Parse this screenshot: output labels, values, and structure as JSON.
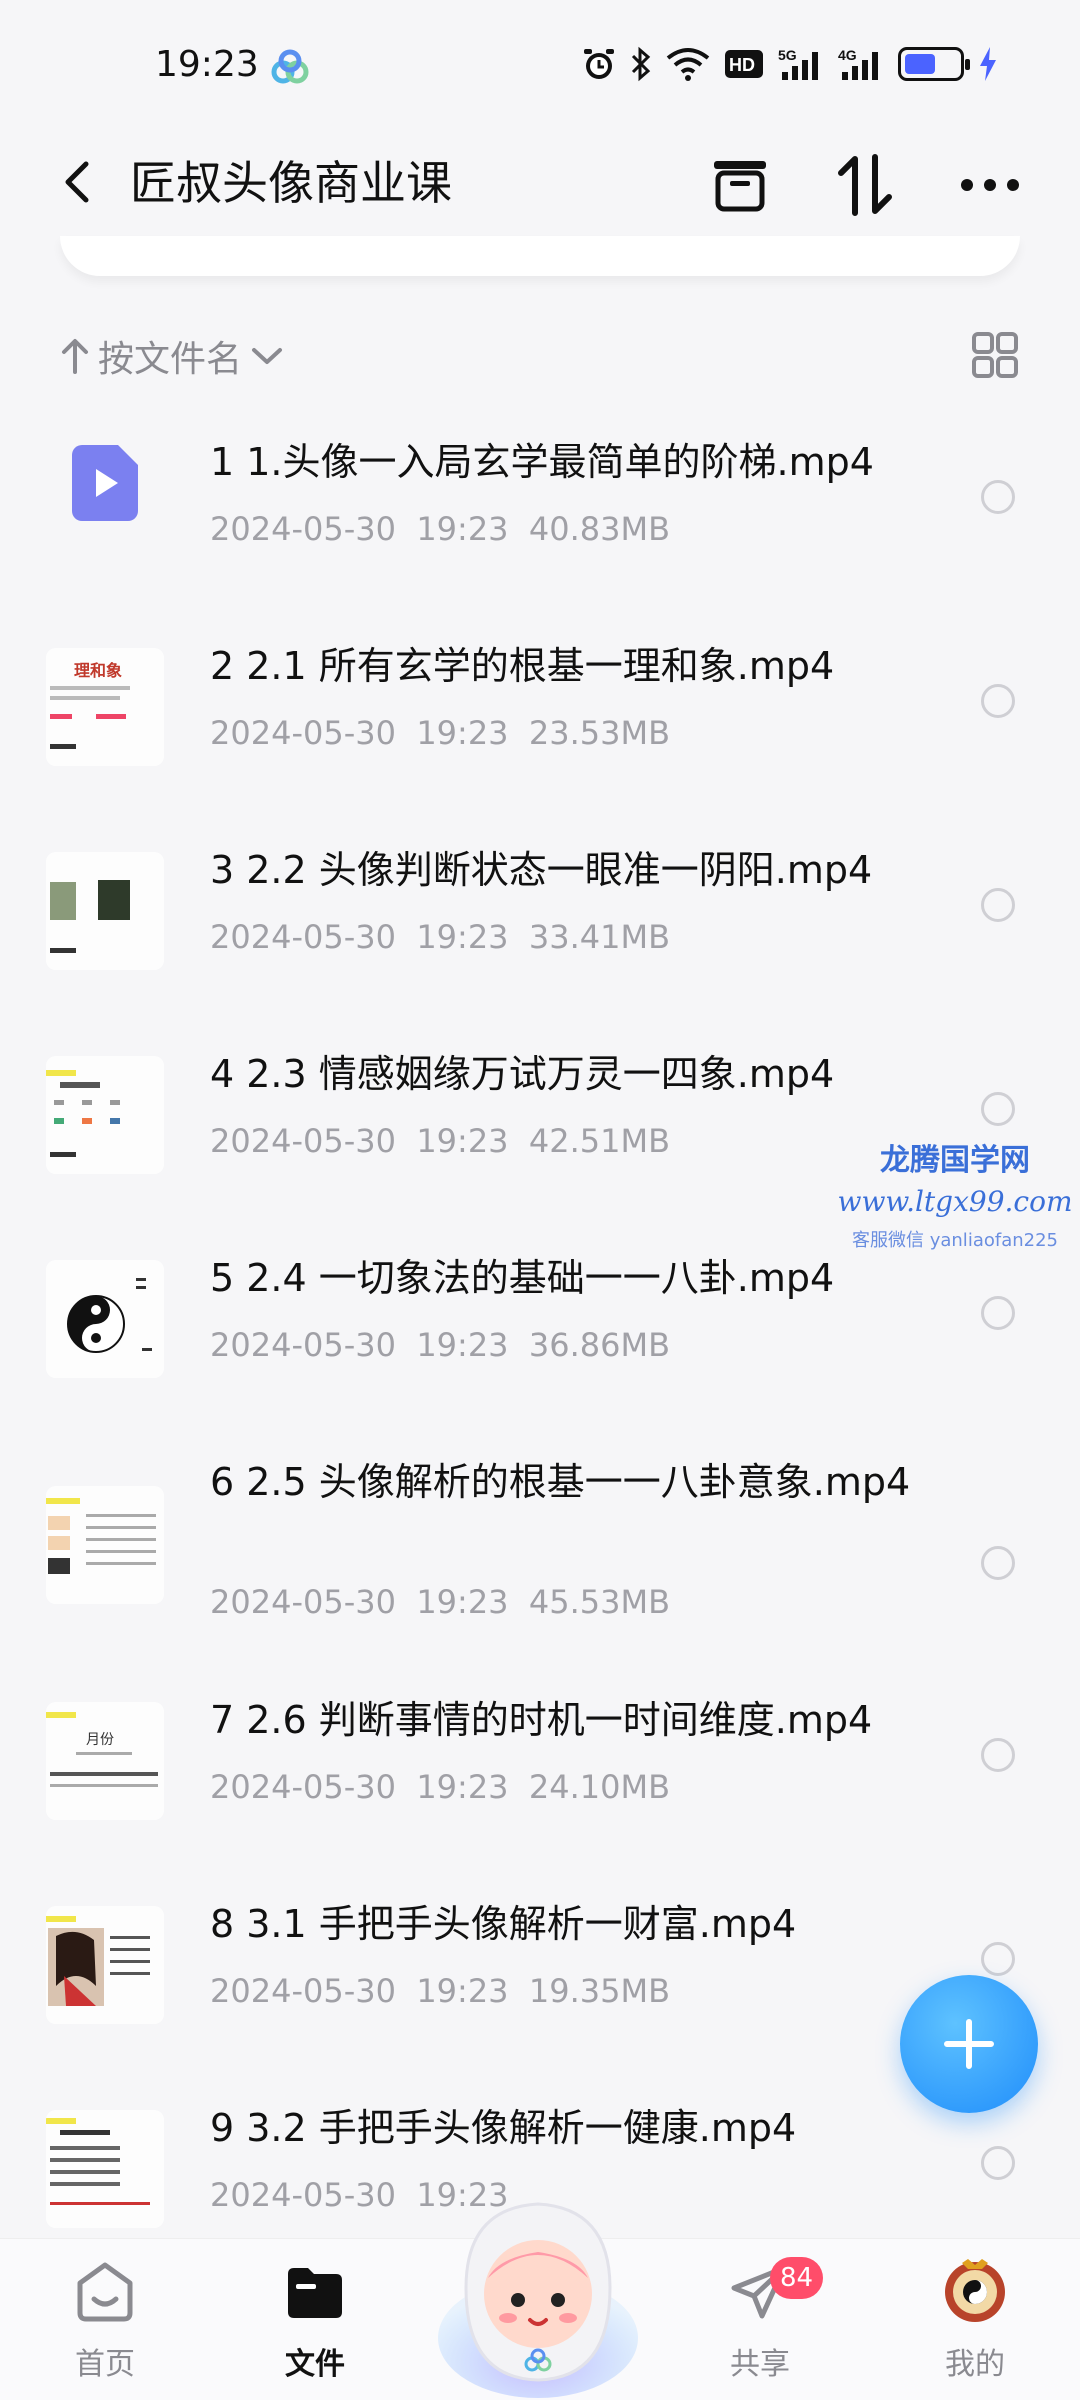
{
  "status": {
    "time": "19:23",
    "net_5g": "5G",
    "net_4g": "4G",
    "hd": "HD"
  },
  "header": {
    "title": "匠叔头像商业课"
  },
  "sort": {
    "label": "按文件名"
  },
  "files": [
    {
      "name": "1 1.头像一入局玄学最简单的阶梯.mp4",
      "date": "2024-05-30",
      "time": "19:23",
      "size": "40.83MB",
      "thumb": "video-icon"
    },
    {
      "name": "2 2.1 所有玄学的根基一理和象.mp4",
      "date": "2024-05-30",
      "time": "19:23",
      "size": "23.53MB",
      "thumb": "slide-thumbnail"
    },
    {
      "name": "3 2.2 头像判断状态一眼准一阴阳.mp4",
      "date": "2024-05-30",
      "time": "19:23",
      "size": "33.41MB",
      "thumb": "slide-thumbnail"
    },
    {
      "name": "4 2.3 情感姻缘万试万灵一四象.mp4",
      "date": "2024-05-30",
      "time": "19:23",
      "size": "42.51MB",
      "thumb": "slide-thumbnail"
    },
    {
      "name": "5 2.4 一切象法的基础一一八卦.mp4",
      "date": "2024-05-30",
      "time": "19:23",
      "size": "36.86MB",
      "thumb": "yin-yang-thumbnail"
    },
    {
      "name": "6 2.5 头像解析的根基一一八卦意象.mp4",
      "date": "2024-05-30",
      "time": "19:23",
      "size": "45.53MB",
      "thumb": "slide-thumbnail"
    },
    {
      "name": "7 2.6 判断事情的时机一时间维度.mp4",
      "date": "2024-05-30",
      "time": "19:23",
      "size": "24.10MB",
      "thumb": "slide-thumbnail"
    },
    {
      "name": "8 3.1 手把手头像解析一财富.mp4",
      "date": "2024-05-30",
      "time": "19:23",
      "size": "19.35MB",
      "thumb": "slide-thumbnail"
    },
    {
      "name": "9 3.2 手把手头像解析一健康.mp4",
      "date": "2024-05-30",
      "time": "19:23",
      "size": "",
      "thumb": "slide-thumbnail"
    }
  ],
  "thumb_text": {
    "slide1_title": "理和象",
    "slide7_title": "月份"
  },
  "watermark": {
    "line1": "龙腾国学网",
    "line2": "www.ltgx99.com",
    "line3": "客服微信 yanliaofan225"
  },
  "nav": {
    "home": "首页",
    "files": "文件",
    "share": "共享",
    "mine": "我的",
    "share_badge": "84"
  },
  "colors": {
    "accent": "#1f8dfb",
    "badge": "#ff4d6a",
    "video_icon": "#7b80f0"
  }
}
